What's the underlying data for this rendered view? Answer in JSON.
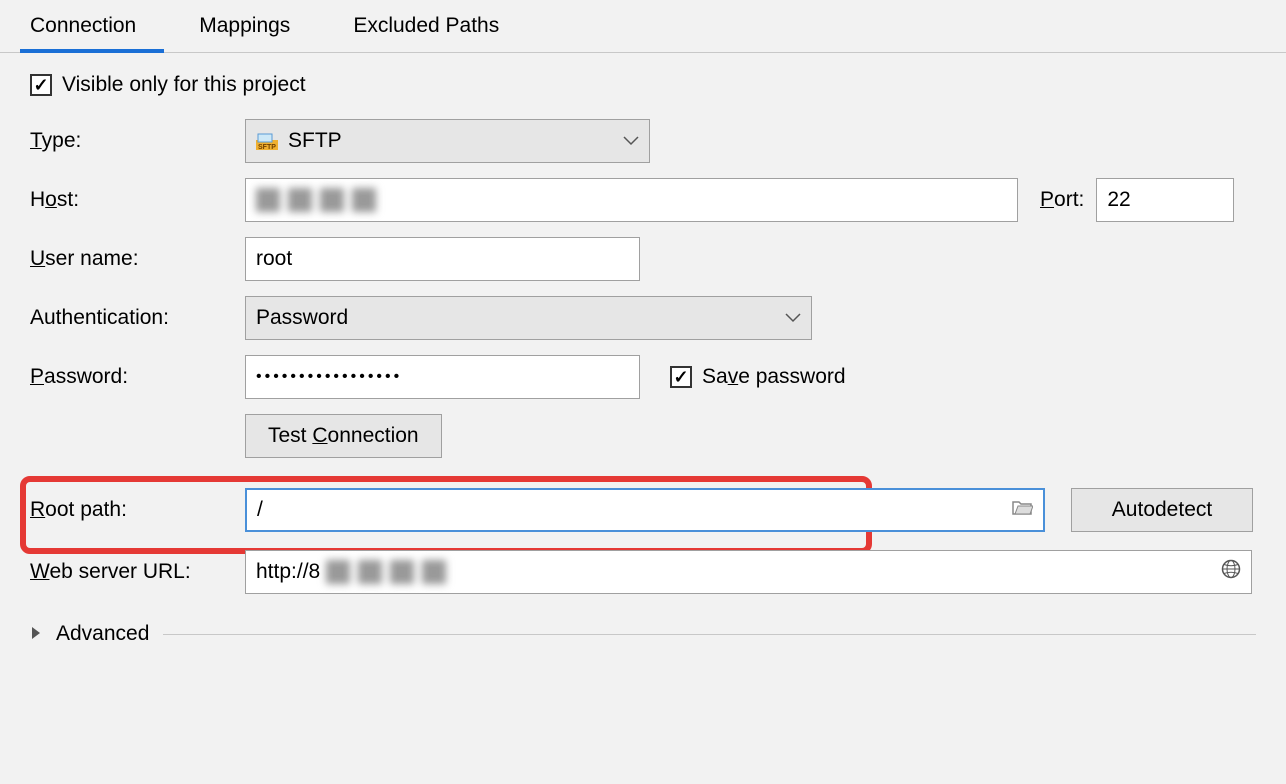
{
  "tabs": {
    "connection": "Connection",
    "mappings": "Mappings",
    "excluded": "Excluded Paths"
  },
  "form": {
    "visible_only_label": "Visible only for this project",
    "type_label": "Type:",
    "type_value": "SFTP",
    "host_label": "Host:",
    "host_value": "",
    "port_label": "Port:",
    "port_value": "22",
    "username_label": "User name:",
    "username_value": "root",
    "auth_label": "Authentication:",
    "auth_value": "Password",
    "password_label": "Password:",
    "password_value": "•••••••••••••••••",
    "save_password_label": "Save password",
    "test_connection_label": "Test Connection",
    "rootpath_label": "Root path:",
    "rootpath_value": "/",
    "autodetect_label": "Autodetect",
    "webserver_label": "Web server URL:",
    "webserver_value_prefix": "http://8",
    "advanced_label": "Advanced"
  },
  "mnemonics": {
    "type": "T",
    "host": "o",
    "port": "P",
    "username": "U",
    "password": "P",
    "save_pw": "v",
    "test_conn": "C",
    "rootpath": "R",
    "webserver": "W"
  }
}
